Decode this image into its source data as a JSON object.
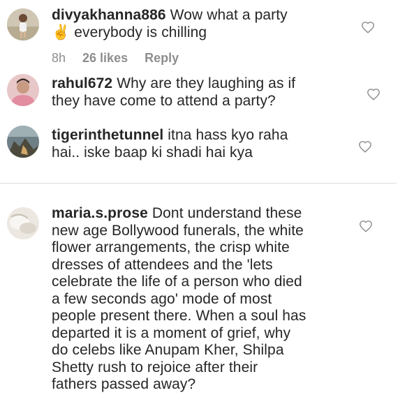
{
  "comments": [
    {
      "username": "divyakhanna886",
      "line1": "Wow what a party",
      "emoji": "✌️",
      "line2": "everybody is chilling",
      "meta": {
        "time": "8h",
        "likes": "26 likes",
        "reply": "Reply"
      }
    },
    {
      "username": "rahul672",
      "line1": "Why are they laughing as if",
      "line2": "they have come to attend a party?"
    },
    {
      "username": "tigerinthetunnel",
      "line1": "itna hass kyo raha",
      "line2": "hai.. iske baap ki shadi hai kya"
    },
    {
      "username": "maria.s.prose",
      "line1": "Dont understand these",
      "lines": [
        "new age Bollywood funerals, the white",
        "flower arrangements, the crisp white",
        "dresses of attendees and the 'lets",
        "celebrate the life of a person who died",
        "a few seconds ago' mode of most",
        "people present there. When a soul has",
        "departed it is a moment of grief, why",
        "do celebs like Anupam Kher, Shilpa",
        "Shetty rush to rejoice after their",
        "fathers passed away?"
      ]
    }
  ],
  "icons": {
    "like": "heart-outline-icon"
  },
  "colors": {
    "text": "#262626",
    "meta": "#8e8e8e",
    "divider": "#dbdbdb"
  }
}
